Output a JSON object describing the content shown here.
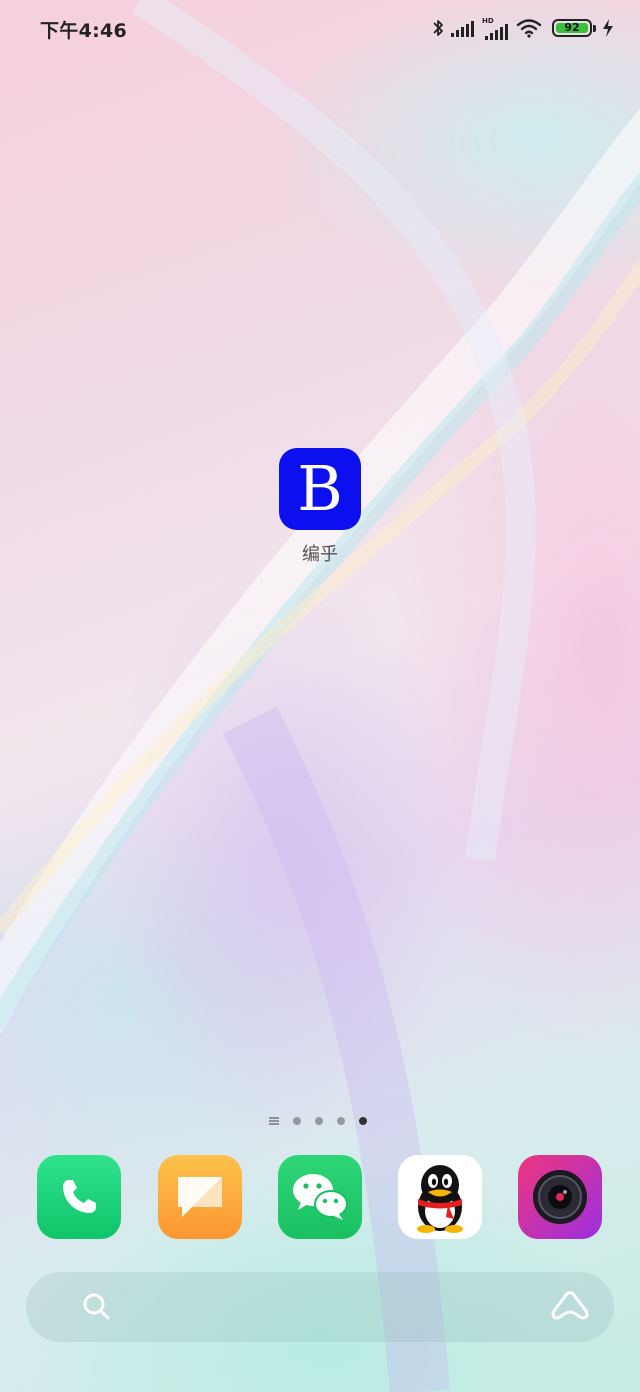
{
  "status_bar": {
    "time": "下午4:46",
    "hd_label": "HD",
    "battery_level": "92",
    "icons": [
      "bluetooth-icon",
      "signal-icon",
      "signal-hd-icon",
      "wifi-icon",
      "battery-icon",
      "charging-icon"
    ]
  },
  "home": {
    "apps": [
      {
        "label": "编乎",
        "icon": "biannhu-app-icon",
        "icon_letter": "B",
        "color": "#0d10ee"
      }
    ]
  },
  "page_indicator": {
    "pages": 4,
    "current_page": 4
  },
  "dock": {
    "apps": [
      {
        "icon": "phone-app-icon",
        "color": "#1bd07a"
      },
      {
        "icon": "messages-app-icon",
        "color": "#fdb13c"
      },
      {
        "icon": "wechat-app-icon",
        "color": "#1fc96a"
      },
      {
        "icon": "qq-app-icon",
        "color": "#ffffff"
      },
      {
        "icon": "camera-app-icon",
        "color": "#d42aa6"
      }
    ]
  },
  "search_bar": {
    "icons": [
      "search-icon",
      "lens-icon"
    ]
  }
}
